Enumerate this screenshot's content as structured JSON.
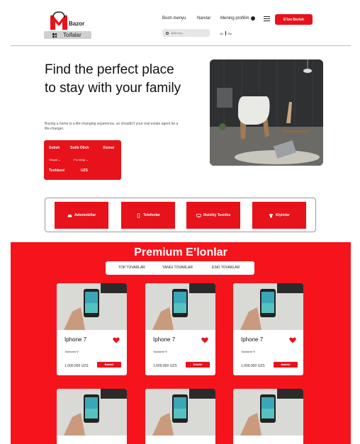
{
  "header": {
    "logo_text": "Bazor",
    "category_button": "Toifalar",
    "nav": [
      "Bosh menyu",
      "Narxlar",
      "Mening profilim"
    ],
    "post_button": "E'lon Berish",
    "search_placeholder": "Qidirmoq...",
    "languages": [
      "Uz",
      "Ru"
    ]
  },
  "hero": {
    "title": "Find the perfect place to stay with your family",
    "subtitle": "Buying a home is a life-changing experience, so shouldn't your real estate agent be a life-changer.",
    "filter": {
      "tabs": [
        "Sotish",
        "Sotib Olish",
        "Xizmat"
      ],
      "dropdowns": [
        "Viloyat",
        "Pul birligi"
      ],
      "location": "Toshkent",
      "currency": "UZS"
    }
  },
  "categories": [
    {
      "label": "Avtomobillar",
      "icon": "car-icon"
    },
    {
      "label": "Telefonlar",
      "icon": "phone-icon"
    },
    {
      "label": "Maishiy Texnika",
      "icon": "monitor-icon"
    },
    {
      "label": "Kiyimlar",
      "icon": "shirt-icon"
    }
  ],
  "premium": {
    "title": "Premium E’lonlar",
    "tabs": [
      "TOP TOVARLAR",
      "YANGI TOVARLAR",
      "ESKI TOVARLAR"
    ],
    "cards": [
      {
        "name": "Iphone 7",
        "location": "Toshkent",
        "price": "1.000.000 UZS",
        "button": "Batafsil"
      },
      {
        "name": "Iphone 7",
        "location": "Toshkent",
        "price": "1.000.000 UZS",
        "button": "Batafsil"
      },
      {
        "name": "Iphone 7",
        "location": "Toshkent",
        "price": "1.000.000 UZS",
        "button": "Batafsil"
      }
    ]
  },
  "colors": {
    "accent": "#e8121b",
    "premium_bg": "#f5141c"
  }
}
